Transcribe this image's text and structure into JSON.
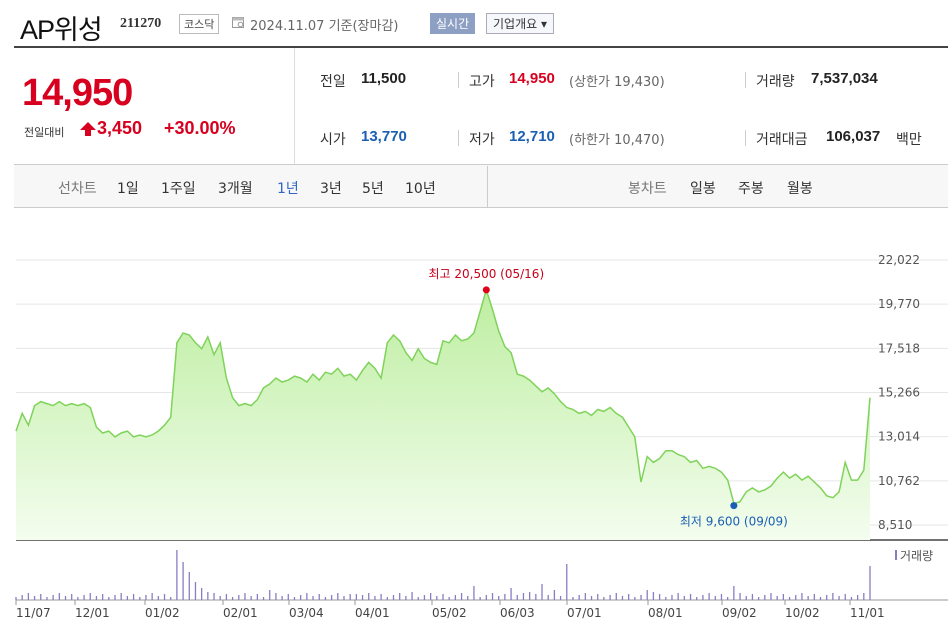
{
  "header": {
    "title": "AP위성",
    "code": "211270",
    "market": "코스닥",
    "as_of": "2024.11.07 기준(장마감)",
    "realtime_label": "실시간",
    "overview_label": "기업개요 ▾"
  },
  "summary": {
    "price": "14,950",
    "prev_label": "전일대비",
    "change": "3,450",
    "change_pct": "+30.00%",
    "prev_close_label": "전일",
    "prev_close": "11,500",
    "high_label": "고가",
    "high": "14,950",
    "upper_limit": "(상한가 19,430)",
    "volume_label": "거래량",
    "volume": "7,537,034",
    "open_label": "시가",
    "open": "13,770",
    "low_label": "저가",
    "low": "12,710",
    "lower_limit": "(하한가 10,470)",
    "amount_label": "거래대금",
    "amount": "106,037",
    "amount_unit": "백만"
  },
  "periods": {
    "line_label": "선차트",
    "items": [
      "1일",
      "1주일",
      "3개월",
      "1년",
      "3년",
      "5년",
      "10년"
    ],
    "selected": "1년",
    "candle_label": "봉차트",
    "candle_items": [
      "일봉",
      "주봉",
      "월봉"
    ]
  },
  "colors": {
    "up": "#d7001f",
    "down": "#1a5fb4",
    "line": "#7fd35a",
    "fill_top": "#c5f0a8"
  },
  "chart_data": {
    "type": "area",
    "y_ticks": [
      "22,022",
      "19,770",
      "17,518",
      "15,266",
      "13,014",
      "10,762",
      "8,510"
    ],
    "ylim": [
      8510,
      22022
    ],
    "x_ticks": [
      "11/07",
      "12/01",
      "01/02",
      "02/01",
      "03/04",
      "04/01",
      "05/02",
      "06/03",
      "07/01",
      "08/01",
      "09/02",
      "10/02",
      "11/01"
    ],
    "high_annotation": "최고 20,500 (05/16)",
    "low_annotation": "최저 9,600 (09/09)",
    "volume_label": "거래량",
    "series": [
      {
        "values": [
          13300,
          14200,
          13600,
          14600,
          14800,
          14700,
          14600,
          14800,
          14600,
          14700,
          14600,
          14700,
          14500,
          13500,
          13200,
          13300,
          13000,
          13200,
          13300,
          13000,
          13100,
          13000,
          13100,
          13300,
          13600,
          14000,
          17800,
          18300,
          18200,
          17800,
          17500,
          18100,
          17200,
          17800,
          16000,
          15000,
          14600,
          14700,
          14600,
          14900,
          15500,
          15700,
          16000,
          15800,
          15900,
          16100,
          16000,
          15800,
          16200,
          15900,
          16300,
          16200,
          16500,
          16100,
          16200,
          15900,
          16400,
          16800,
          16500,
          16000,
          17800,
          18200,
          17900,
          17300,
          16900,
          17500,
          17000,
          16800,
          16700,
          17900,
          17800,
          18200,
          17900,
          18000,
          18300,
          19400,
          20500,
          19500,
          18400,
          17600,
          17300,
          16200,
          16100,
          15900,
          15600,
          15300,
          15500,
          15200,
          14800,
          14500,
          14400,
          14200,
          14300,
          14100,
          14400,
          14300,
          14500,
          14200,
          14000,
          13500,
          13000,
          10700,
          12000,
          11700,
          11900,
          12300,
          12300,
          12100,
          12000,
          11700,
          11800,
          11400,
          11500,
          11400,
          11200,
          10800,
          9600,
          9700,
          10200,
          10400,
          10200,
          10300,
          10500,
          10900,
          11200,
          10900,
          11100,
          10800,
          11000,
          10700,
          10400,
          10000,
          9900,
          10200,
          11700,
          10800,
          10800,
          11300,
          15000
        ]
      }
    ]
  }
}
